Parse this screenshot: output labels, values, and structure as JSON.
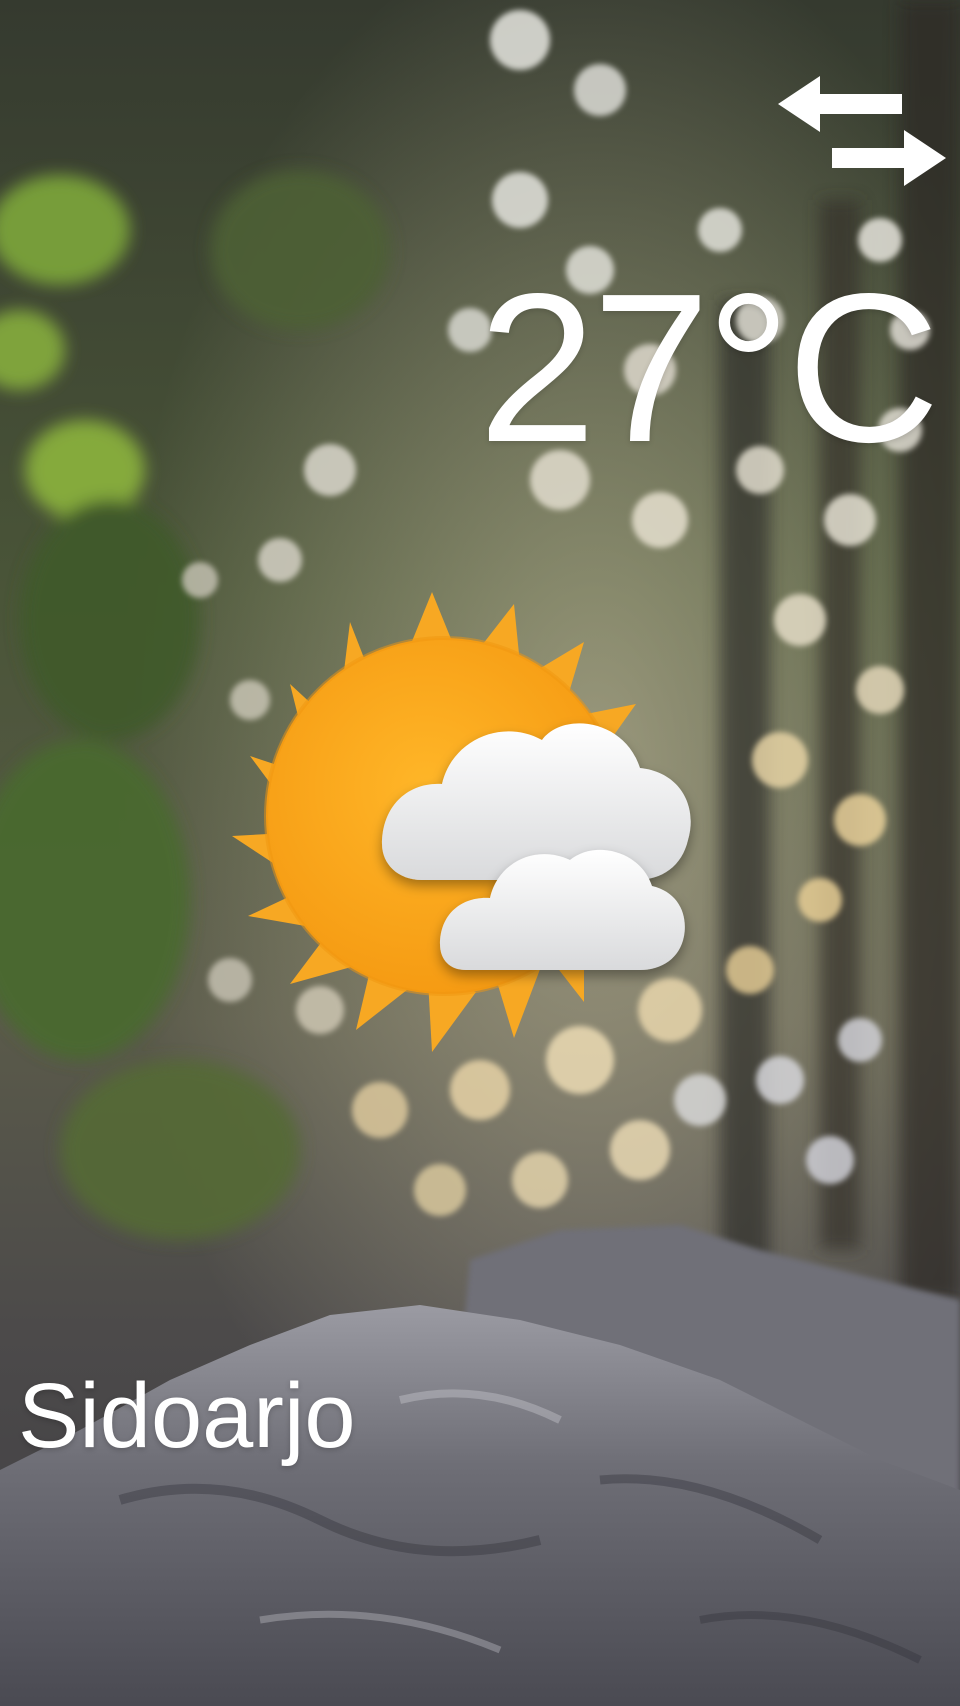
{
  "background": {
    "icon": "forest-bokeh-background",
    "colors": [
      "#2f3a2c",
      "#5d7a3a",
      "#e8e4d4",
      "#d9c393",
      "#8a8d92"
    ]
  },
  "toolbar": {
    "swap_icon": "swap-arrows-icon"
  },
  "weather": {
    "temperature": "27°C",
    "condition_icon": "partly-cloudy-sun-icon",
    "sun_color": "#f7a823",
    "city": "Sidoarjo"
  }
}
